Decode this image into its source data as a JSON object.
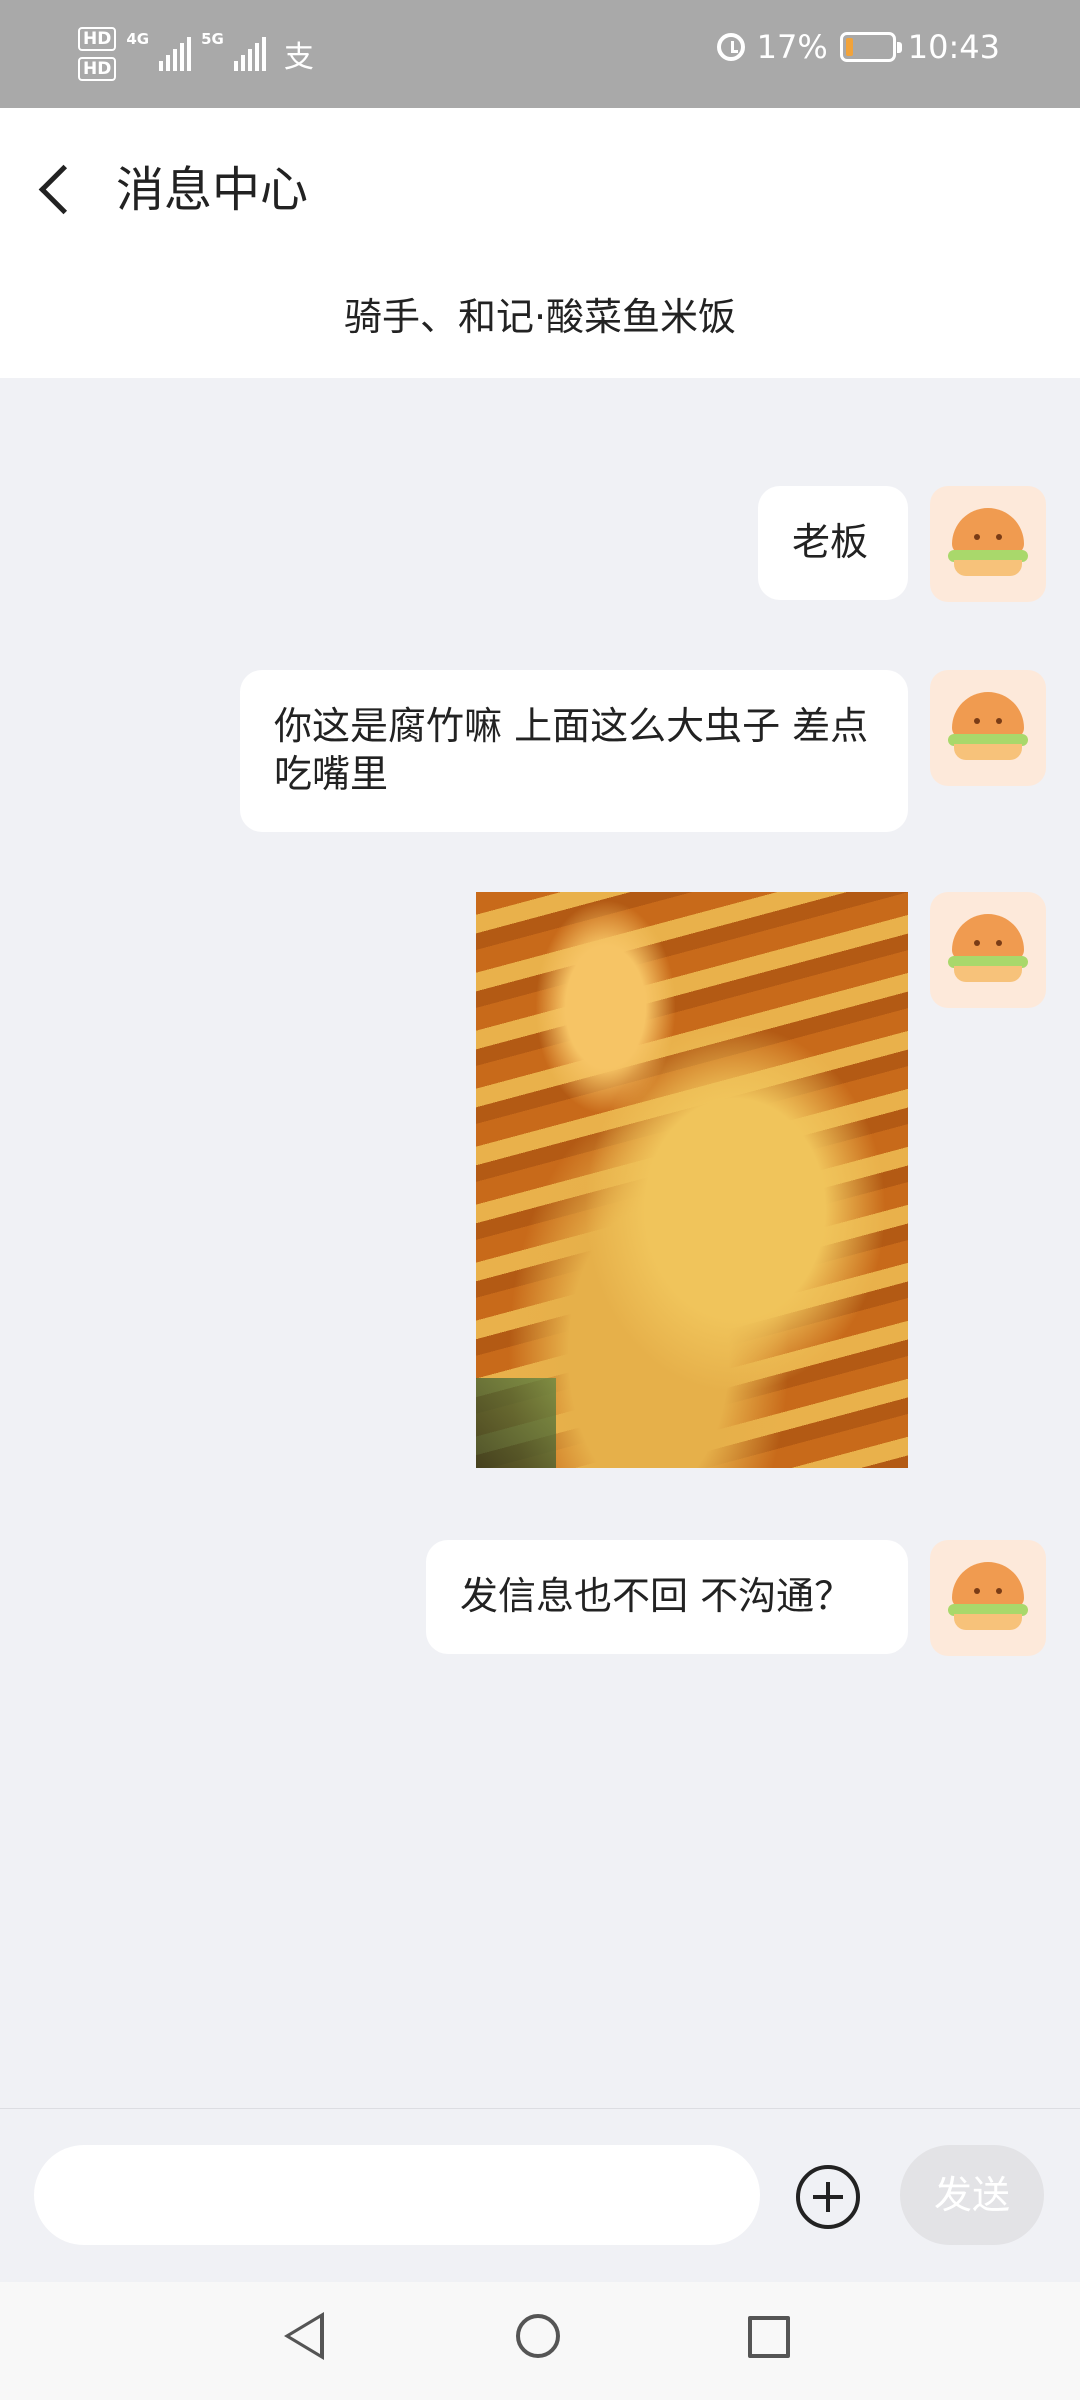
{
  "status_bar": {
    "hd1": "HD",
    "hd2": "HD",
    "net1": "4G",
    "net2": "5G",
    "pay_icon": "支",
    "battery_percent": "17%",
    "battery_level": 0.17,
    "time": "10:43"
  },
  "header": {
    "title": "消息中心",
    "subtitle": "骑手、和记·酸菜鱼米饭"
  },
  "messages": [
    {
      "type": "text",
      "text": "老板"
    },
    {
      "type": "text",
      "text": "你这是腐竹嘛 上面这么大虫子 差点吃嘴里"
    },
    {
      "type": "image"
    },
    {
      "type": "text",
      "text": "发信息也不回 不沟通？"
    }
  ],
  "input_bar": {
    "placeholder": "",
    "send_label": "发送"
  },
  "icons": {
    "back": "chevron-left-icon",
    "plus": "plus-circle-icon",
    "avatar": "burger-avatar-icon",
    "nav_back": "triangle-back-icon",
    "nav_home": "circle-home-icon",
    "nav_recent": "square-recent-icon"
  },
  "colors": {
    "status_bar_bg": "#a9a9a9",
    "chat_bg": "#f0f1f5",
    "bubble_bg": "#ffffff",
    "battery_fill": "#f2a33a",
    "send_button_bg": "#e3e3e6"
  }
}
